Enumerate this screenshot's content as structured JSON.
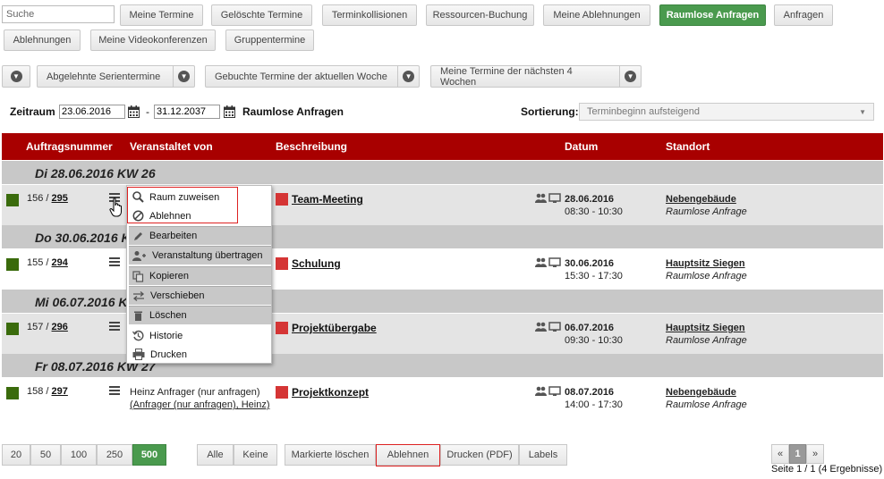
{
  "search": {
    "placeholder": "Suche"
  },
  "tabs": [
    "Meine Termine",
    "Gelöschte Termine",
    "Terminkollisionen",
    "Ressourcen-Buchung",
    "Meine Ablehnungen",
    "Raumlose Anfragen",
    "Anfragen",
    "Ablehnungen",
    "Meine Videokonferenzen",
    "Gruppentermine"
  ],
  "active_tab": "Raumlose Anfragen",
  "quickfilters": [
    "Abgelehnte Serientermine",
    "Gebuchte Termine der aktuellen Woche",
    "Meine Termine der nächsten 4 Wochen"
  ],
  "filter": {
    "zeitraum_label": "Zeitraum",
    "from": "23.06.2016",
    "separator": "-",
    "to": "31.12.2037",
    "title": "Raumlose Anfragen",
    "sort_label": "Sortierung:",
    "sort_value": "Terminbeginn aufsteigend"
  },
  "table": {
    "headers": [
      "Auftragsnummer",
      "Veranstaltet von",
      "Beschreibung",
      "Datum",
      "Standort"
    ]
  },
  "days": [
    "Di 28.06.2016 KW 26",
    "Do 30.06.2016 KW 26",
    "Mi 06.07.2016 KW 27",
    "Fr 08.07.2016 KW 27"
  ],
  "rows": [
    {
      "num": "156",
      "link": "295",
      "host": "",
      "host_link": "",
      "desc": "Team-Meeting",
      "date": "28.06.2016",
      "time": "08:30 - 10:30",
      "loc": "Nebengebäude",
      "status": "Raumlose Anfrage"
    },
    {
      "num": "155",
      "link": "294",
      "host": "",
      "host_link": "",
      "desc": "Schulung",
      "date": "30.06.2016",
      "time": "15:30 - 17:30",
      "loc": "Hauptsitz Siegen",
      "status": "Raumlose Anfrage"
    },
    {
      "num": "157",
      "link": "296",
      "host": "",
      "host_link": "",
      "desc": "Projektübergabe",
      "date": "06.07.2016",
      "time": "09:30 - 10:30",
      "loc": "Hauptsitz Siegen",
      "status": "Raumlose Anfrage"
    },
    {
      "num": "158",
      "link": "297",
      "host": "Heinz Anfrager (nur anfragen)",
      "host_link": "(Anfrager (nur anfragen), Heinz)",
      "desc": "Projektkonzept",
      "date": "08.07.2016",
      "time": "14:00 - 17:30",
      "loc": "Nebengebäude",
      "status": "Raumlose Anfrage"
    }
  ],
  "context_menu": [
    "Raum zuweisen",
    "Ablehnen",
    "Bearbeiten",
    "Veranstaltung übertragen",
    "Kopieren",
    "Verschieben",
    "Löschen",
    "Historie",
    "Drucken"
  ],
  "page_sizes": [
    "20",
    "50",
    "100",
    "250",
    "500"
  ],
  "active_page_size": "500",
  "actions": [
    "Alle",
    "Keine",
    "Markierte löschen",
    "Ablehnen",
    "Drucken (PDF)",
    "Labels"
  ],
  "pager": {
    "prev": "«",
    "current": "1",
    "next": "»",
    "summary": "Seite 1 / 1 (4 Ergebnisse)"
  },
  "colors": {
    "header_red": "#a80000",
    "active_green": "#4a9a4e",
    "status_green": "#3a6b0c",
    "desc_red": "#d53535"
  }
}
